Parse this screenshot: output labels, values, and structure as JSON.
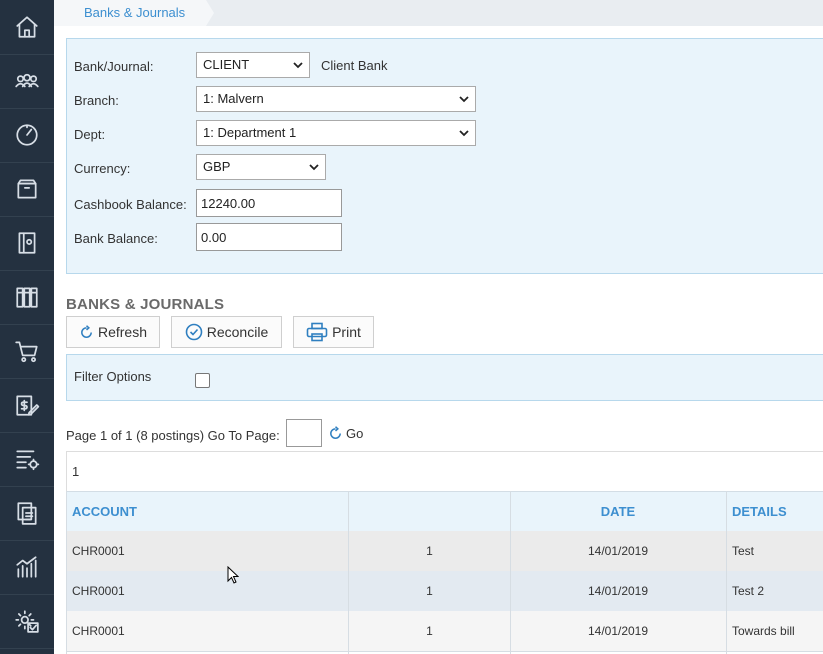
{
  "sidebar": {
    "items": [
      {
        "icon": "home-icon"
      },
      {
        "icon": "users-icon"
      },
      {
        "icon": "dashboard-icon"
      },
      {
        "icon": "archive-icon"
      },
      {
        "icon": "notebook-icon"
      },
      {
        "icon": "books-icon"
      },
      {
        "icon": "cart-icon"
      },
      {
        "icon": "invoice-edit-icon"
      },
      {
        "icon": "list-settings-icon"
      },
      {
        "icon": "documents-icon"
      },
      {
        "icon": "reports-chart-icon"
      },
      {
        "icon": "settings-check-icon"
      }
    ]
  },
  "breadcrumb": {
    "label": "Banks & Journals"
  },
  "form": {
    "bank_journal": {
      "label": "Bank/Journal:",
      "value": "CLIENT",
      "description": "Client Bank"
    },
    "branch": {
      "label": "Branch:",
      "value": "1: Malvern"
    },
    "dept": {
      "label": "Dept:",
      "value": "1: Department 1"
    },
    "currency": {
      "label": "Currency:",
      "value": "GBP"
    },
    "cashbook_balance": {
      "label": "Cashbook Balance:",
      "value": "12240.00"
    },
    "bank_balance": {
      "label": "Bank Balance:",
      "value": "0.00"
    }
  },
  "section_title": "BANKS & JOURNALS",
  "toolbar": {
    "refresh_label": "Refresh",
    "reconcile_label": "Reconcile",
    "print_label": "Print"
  },
  "filter": {
    "label": "Filter Options",
    "checked": false
  },
  "pager": {
    "summary": "Page 1 of 1 (8 postings) Go To Page:",
    "go_label": "Go",
    "page_input": "",
    "current_page": "1"
  },
  "table": {
    "columns": [
      "ACCOUNT",
      "",
      "DATE",
      "DETAILS"
    ],
    "rows": [
      {
        "account": "CHR0001",
        "num": "1",
        "date": "14/01/2019",
        "details": "Test"
      },
      {
        "account": "CHR0001",
        "num": "1",
        "date": "14/01/2019",
        "details": "Test 2"
      },
      {
        "account": "CHR0001",
        "num": "1",
        "date": "14/01/2019",
        "details": "Towards bill"
      }
    ]
  },
  "colors": {
    "sidebar": "#243140",
    "accent": "#3d8fd0",
    "panel": "#e9f4fb"
  }
}
